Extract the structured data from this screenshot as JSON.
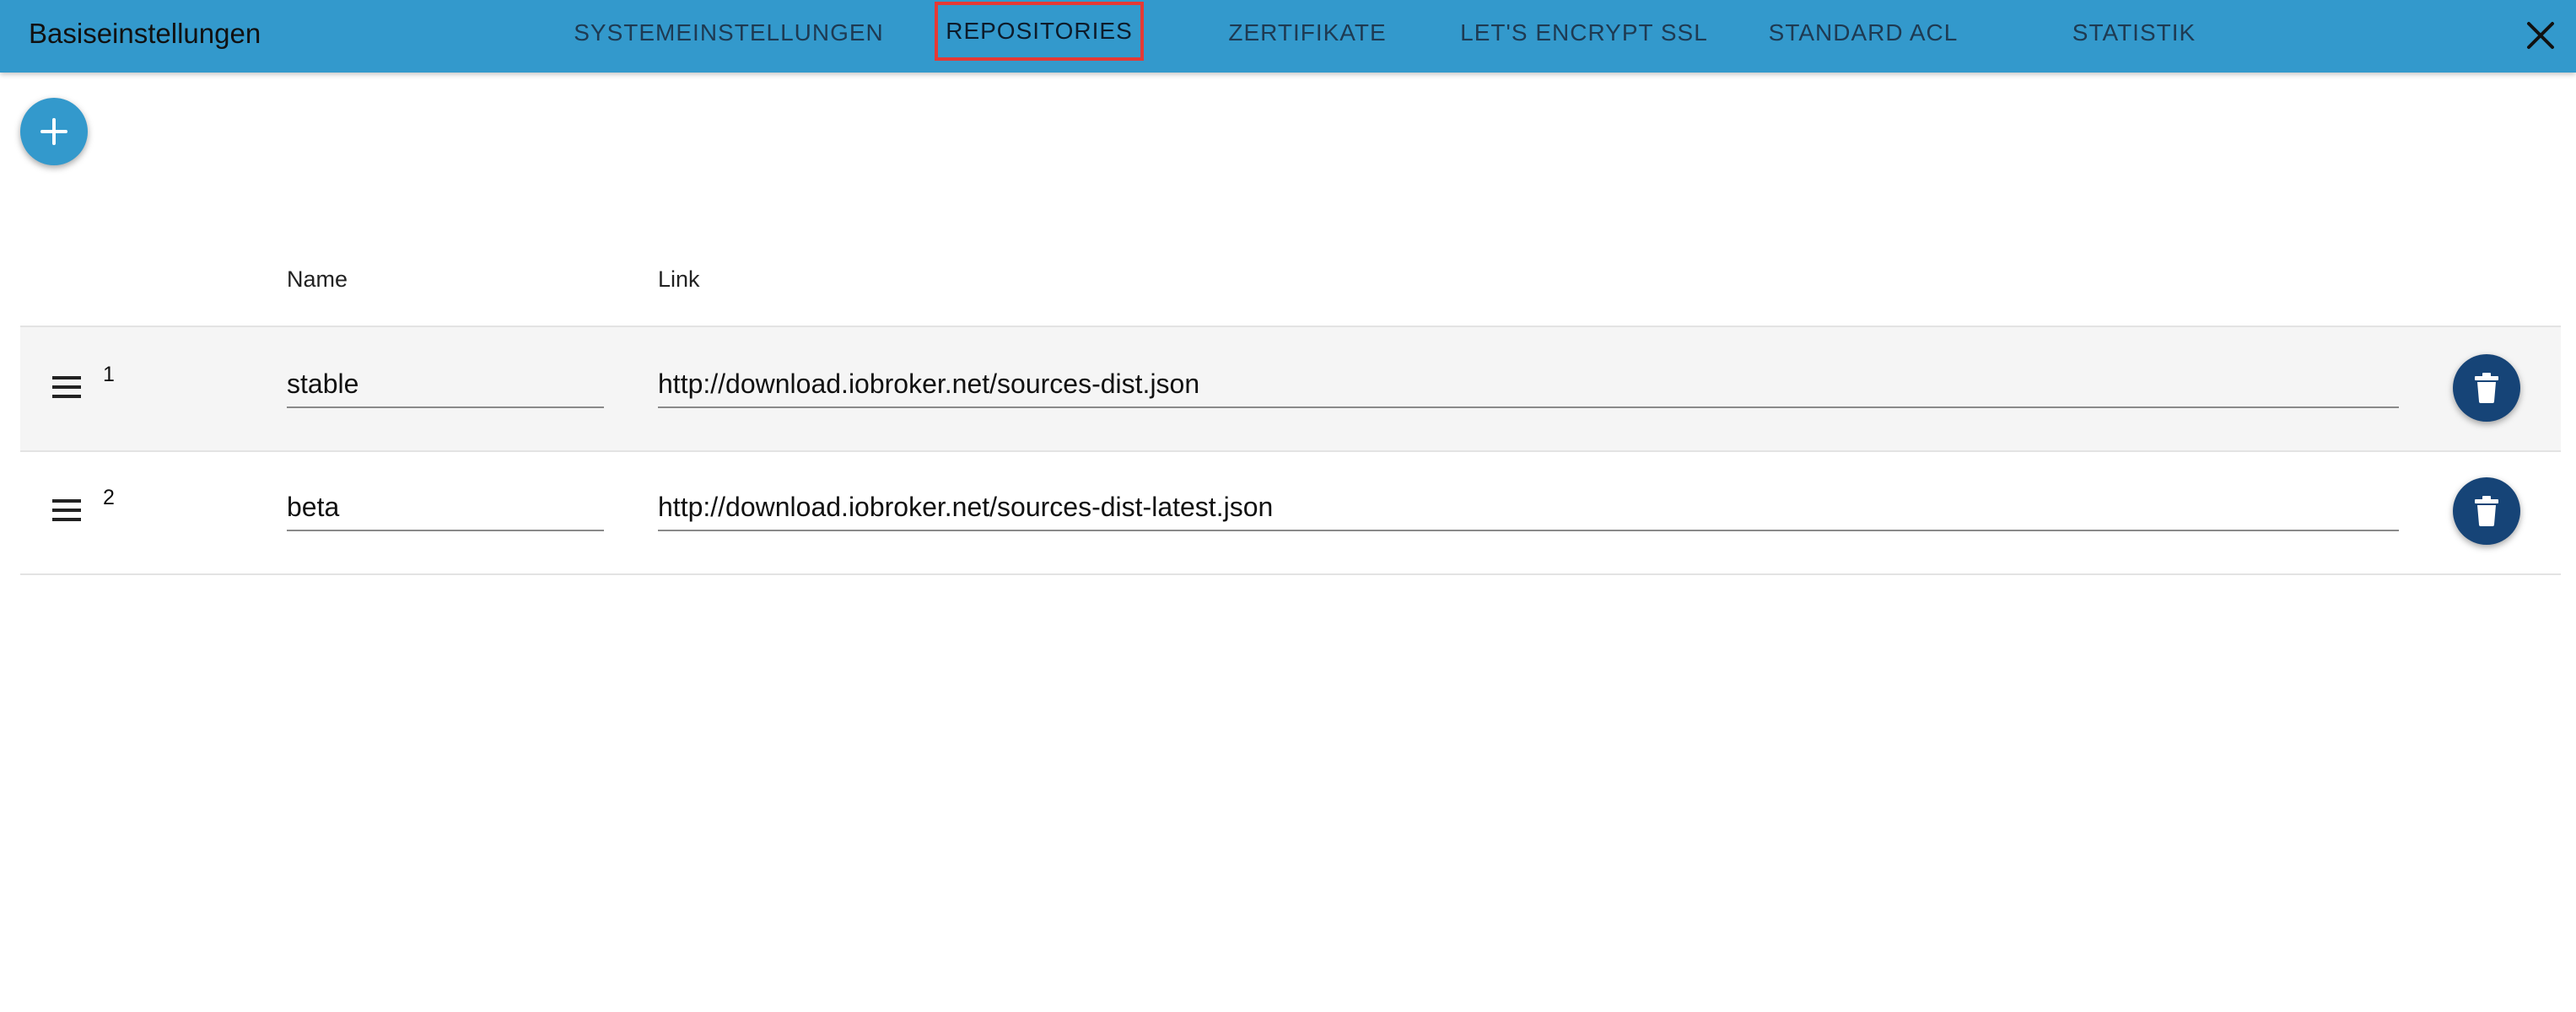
{
  "header": {
    "title": "Basiseinstellungen",
    "tabs": [
      {
        "label": "SYSTEMEINSTELLUNGEN",
        "active": false
      },
      {
        "label": "REPOSITORIES",
        "active": true
      },
      {
        "label": "ZERTIFIKATE",
        "active": false
      },
      {
        "label": "LET'S ENCRYPT SSL",
        "active": false
      },
      {
        "label": "STANDARD ACL",
        "active": false
      },
      {
        "label": "STATISTIK",
        "active": false
      }
    ],
    "close_icon": "close-icon"
  },
  "toolbar": {
    "add_icon": "plus-icon"
  },
  "table": {
    "columns": {
      "name": "Name",
      "link": "Link"
    },
    "rows": [
      {
        "index": "1",
        "name": "stable",
        "link": "http://download.iobroker.net/sources-dist.json"
      },
      {
        "index": "2",
        "name": "beta",
        "link": "http://download.iobroker.net/sources-dist-latest.json"
      }
    ],
    "row_icons": {
      "drag": "drag-handle-icon",
      "delete": "delete-icon"
    }
  },
  "colors": {
    "appbar": "#3399cc",
    "fab_add": "#3399cc",
    "fab_delete": "#164477",
    "active_tab_outline": "#e53935"
  }
}
